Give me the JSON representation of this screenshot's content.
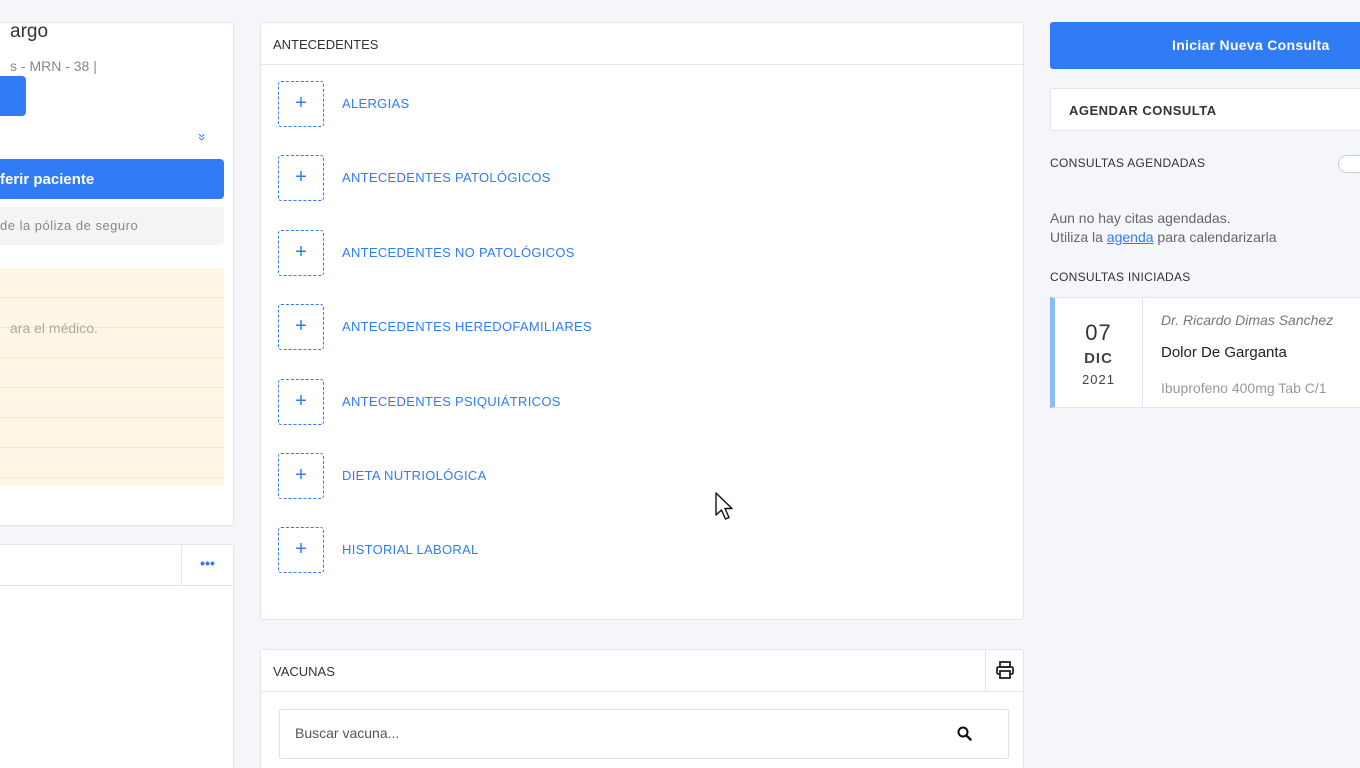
{
  "patient": {
    "name_fragment": "argo",
    "meta_fragment": "s - MRN - 38 |",
    "transfer_label": "ferir paciente",
    "policy_label": "de la póliza de seguro",
    "notes_placeholder": "ara el médico.",
    "more_label": "•••"
  },
  "antecedentes": {
    "title": "ANTECEDENTES",
    "items": [
      {
        "label": "ALERGIAS"
      },
      {
        "label": "ANTECEDENTES PATOLÓGICOS"
      },
      {
        "label": "ANTECEDENTES NO PATOLÓGICOS"
      },
      {
        "label": "ANTECEDENTES HEREDOFAMILIARES"
      },
      {
        "label": "ANTECEDENTES PSIQUIÁTRICOS"
      },
      {
        "label": "DIETA NUTRIOLÓGICA"
      },
      {
        "label": "HISTORIAL LABORAL"
      }
    ],
    "plus_symbol": "+"
  },
  "vacunas": {
    "title": "VACUNAS",
    "search_placeholder": "Buscar vacuna..."
  },
  "right": {
    "start_button": "Iniciar Nueva Consulta",
    "schedule_button": "AGENDAR CONSULTA",
    "scheduled_title": "CONSULTAS AGENDADAS",
    "empty_line1": "Aun no hay citas agendadas.",
    "empty_line2_pre": "Utiliza la",
    "empty_line2_link": "agenda",
    "empty_line2_post": "para calendarizarla",
    "started_title": "CONSULTAS INICIADAS",
    "consult": {
      "day": "07",
      "month": "DIC",
      "year": "2021",
      "doctor": "Dr. Ricardo Dimas Sanchez",
      "reason": "Dolor De Garganta",
      "medication": "Ibuprofeno 400mg Tab C/1"
    }
  },
  "colors": {
    "accent": "#2f7cf6",
    "notes_bg": "#fff6e6"
  }
}
